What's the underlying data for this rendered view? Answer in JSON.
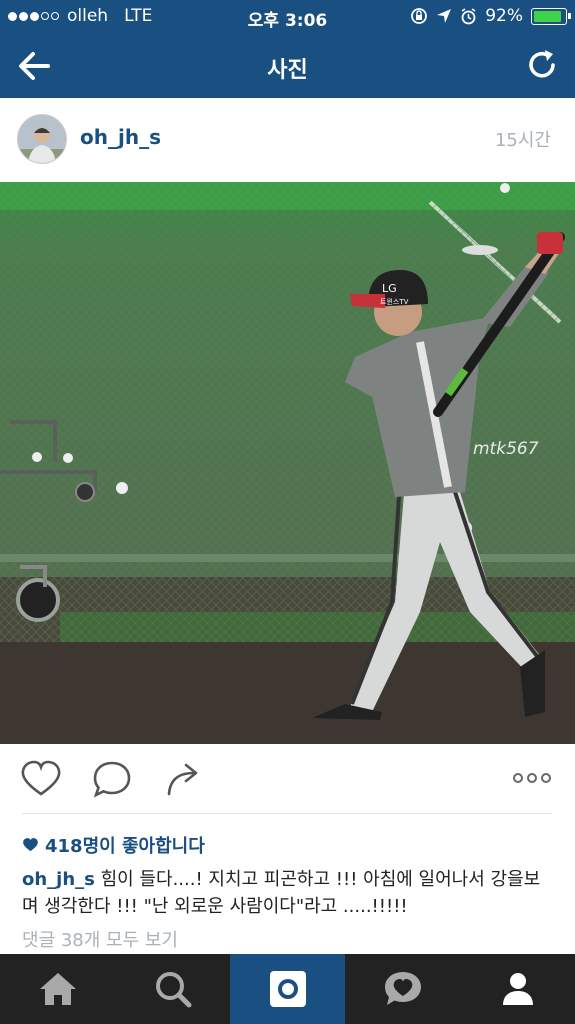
{
  "status_bar": {
    "carrier": "olleh",
    "network": "LTE",
    "time": "오후 3:06",
    "battery_percent": "92%",
    "battery_level": 0.92,
    "signal_strength": 3
  },
  "nav": {
    "title": "사진",
    "back_icon": "arrow-left-icon",
    "refresh_icon": "refresh-icon"
  },
  "post": {
    "username": "oh_jh_s",
    "time_ago": "15시간",
    "watermark": "mtk567",
    "likes_text": "418명이 좋아합니다",
    "caption_user": "oh_jh_s",
    "caption_text": "힘이 들다....! 지치고 피곤하고 !!! 아침에 일어나서 강을보며 생각한다 !!! \"난 외로운 사람이다\"라고 .....!!!!!",
    "comments_link": "댓글 38개 모두 보기",
    "cap_logo_text": "LG",
    "cap_logo_sub": "트윈스TV"
  },
  "actions": {
    "like_icon": "heart-outline-icon",
    "comment_icon": "speech-bubble-icon",
    "share_icon": "share-arrow-icon",
    "more_icon": "more-dots-icon"
  },
  "tabbar": {
    "items": [
      "home-icon",
      "search-icon",
      "camera-icon",
      "activity-icon",
      "profile-icon"
    ],
    "active_index": 2
  },
  "colors": {
    "brand_blue": "#1a4f82",
    "tab_bar_bg": "#222222",
    "muted_text": "#aab1b8"
  }
}
